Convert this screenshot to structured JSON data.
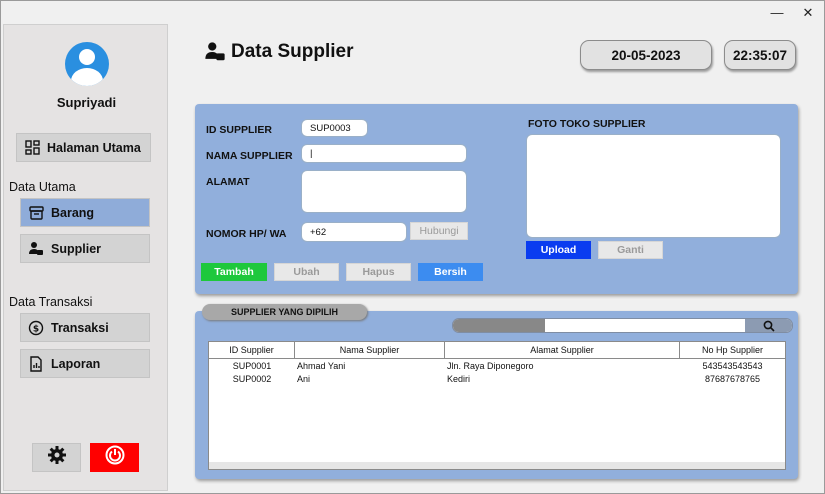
{
  "window": {
    "minimize": "—",
    "close": "✕"
  },
  "sidebar": {
    "username": "Supriyadi",
    "home": "Halaman Utama",
    "section_master": "Data Utama",
    "barang": "Barang",
    "supplier": "Supplier",
    "section_trans": "Data Transaksi",
    "transaksi": "Transaksi",
    "laporan": "Laporan"
  },
  "header": {
    "title": "Data Supplier",
    "date": "20-05-2023",
    "time": "22:35:07"
  },
  "form": {
    "id_label": "ID SUPPLIER",
    "id_value": "SUP0003",
    "name_label": "NAMA SUPPLIER",
    "name_value": "|",
    "address_label": "ALAMAT",
    "address_value": "",
    "phone_label": "NOMOR HP/ WA",
    "phone_value": "+62",
    "hubungi": "Hubungi",
    "photo_label": "FOTO TOKO SUPPLIER",
    "upload": "Upload",
    "ganti": "Ganti",
    "tambah": "Tambah",
    "ubah": "Ubah",
    "hapus": "Hapus",
    "bersih": "Bersih"
  },
  "list": {
    "tab_label": "SUPPLIER YANG DIPILIH",
    "columns": [
      "ID Supplier",
      "Nama Supplier",
      "Alamat Supplier",
      "No Hp Supplier"
    ],
    "rows": [
      [
        "SUP0001",
        "Ahmad Yani",
        "Jln. Raya Diponegoro",
        "543543543543"
      ],
      [
        "SUP0002",
        "Ani",
        "Kediri",
        "87687678765"
      ]
    ]
  },
  "colors": {
    "accent": "#8facd9",
    "tambah": "#1ec83c",
    "bersih": "#3c8cf0",
    "upload": "#0a3cf0",
    "power": "#ff0000"
  },
  "icons": [
    "user-avatar-icon",
    "dashboard-icon",
    "box-icon",
    "supplier-icon",
    "money-icon",
    "report-icon",
    "gear-icon",
    "power-icon",
    "search-icon"
  ]
}
